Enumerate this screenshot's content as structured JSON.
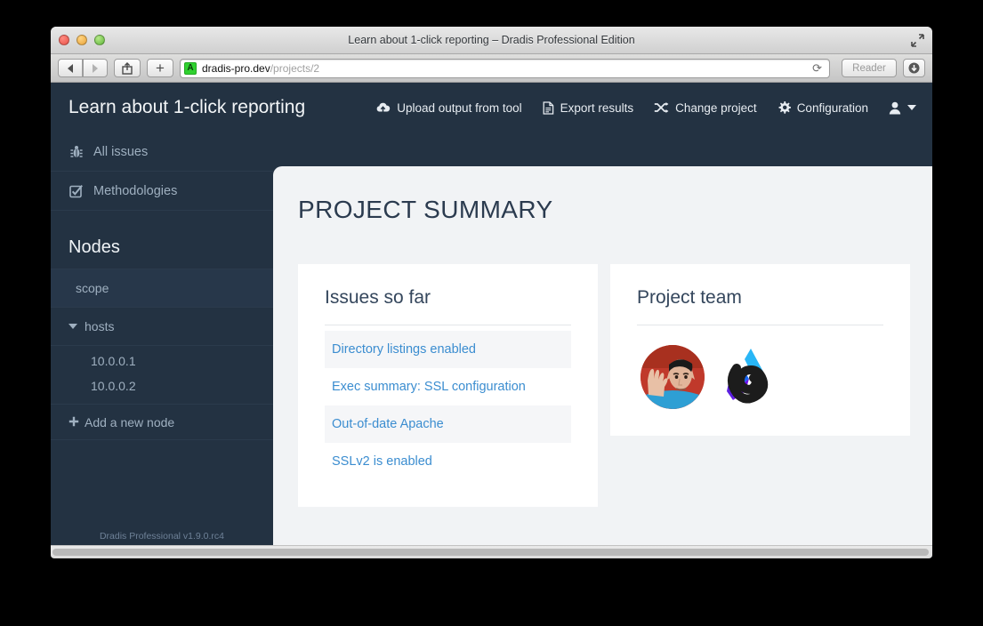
{
  "browser": {
    "window_title": "Learn about 1-click reporting – Dradis Professional Edition",
    "url_host": "dradis-pro.dev",
    "url_path": "/projects/2",
    "favicon_letter": "A",
    "reader_label": "Reader",
    "reload_icon": "reload-icon",
    "back_icon": "back-arrow-icon",
    "forward_icon": "forward-arrow-icon",
    "share_icon": "share-icon",
    "newtab_label": "+",
    "downloads_icon": "download-icon",
    "fullscreen_icon": "fullscreen-icon"
  },
  "app": {
    "title": "Learn about 1-click reporting",
    "nav": [
      {
        "label": "Upload output from tool",
        "icon": "cloud-upload-icon"
      },
      {
        "label": "Export results",
        "icon": "document-icon"
      },
      {
        "label": "Change project",
        "icon": "shuffle-icon"
      },
      {
        "label": "Configuration",
        "icon": "gear-icon"
      }
    ],
    "user_menu": {
      "icon": "user-icon",
      "caret": "caret-down-icon"
    }
  },
  "sidebar": {
    "links": [
      {
        "label": "All issues",
        "icon": "bug-icon"
      },
      {
        "label": "Methodologies",
        "icon": "checked-box-icon"
      }
    ],
    "nodes_heading": "Nodes",
    "nodes": [
      {
        "label": "scope",
        "type": "leaf",
        "shaded": true
      },
      {
        "label": "hosts",
        "type": "group",
        "shaded": false
      }
    ],
    "hosts": [
      "10.0.0.1",
      "10.0.0.2"
    ],
    "add_node_label": "Add a new node",
    "add_node_icon": "plus-icon",
    "footer": "Dradis Professional v1.9.0.rc4"
  },
  "main": {
    "page_title": "PROJECT SUMMARY",
    "issues_card": {
      "title": "Issues so far",
      "issues": [
        "Directory listings enabled",
        "Exec summary: SSL configuration",
        "Out-of-date Apache",
        "SSLv2 is enabled"
      ]
    },
    "team_card": {
      "title": "Project team",
      "avatars": [
        {
          "name": "avatar-spock"
        },
        {
          "name": "avatar-logo"
        }
      ]
    }
  },
  "colors": {
    "dark_navy": "#233242",
    "panel_bg": "#f1f3f5",
    "link_blue": "#3b8dd0",
    "heading_navy": "#2b3b4f",
    "sidebar_text": "#9fb0c0"
  }
}
